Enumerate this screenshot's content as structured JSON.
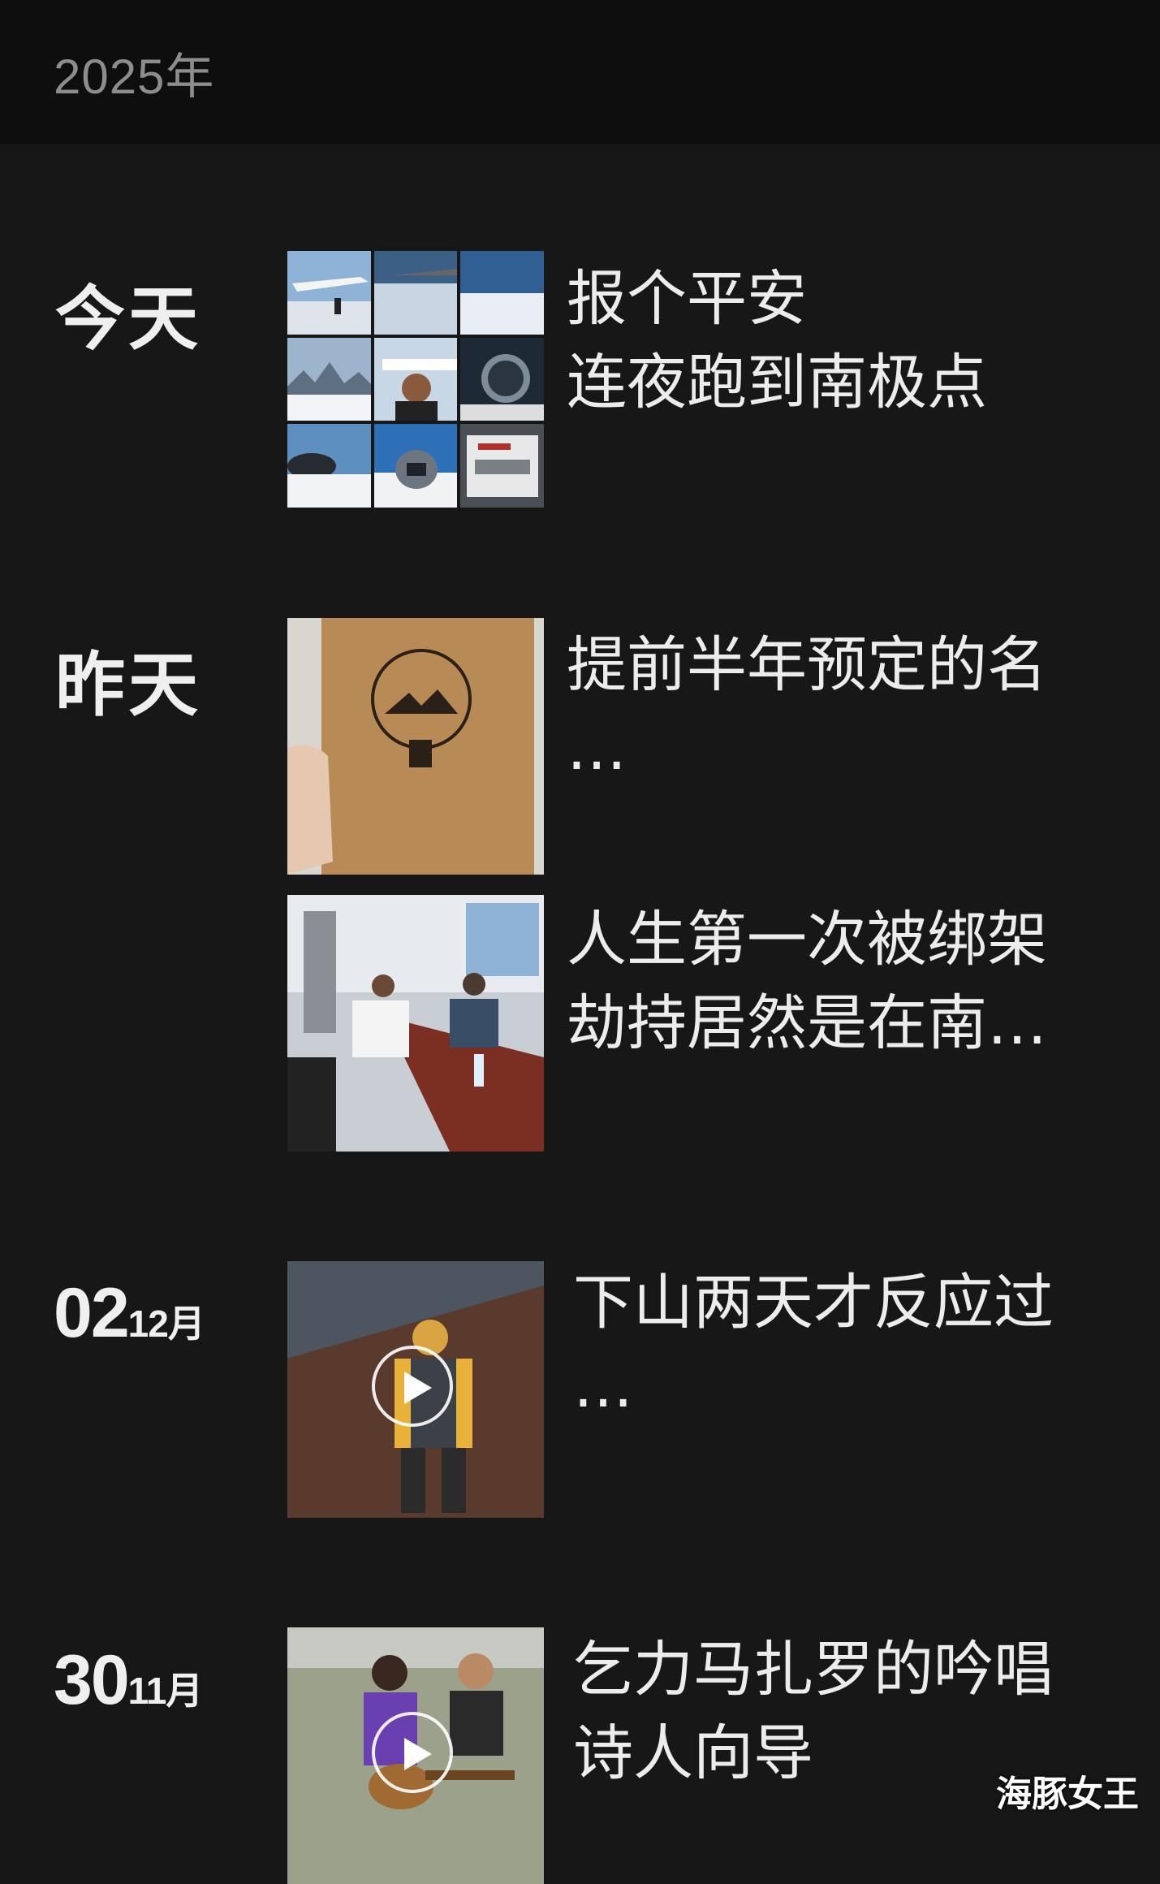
{
  "header": {
    "year": "2025年"
  },
  "entries": [
    {
      "date": "今天",
      "title_line1": "报个平安",
      "title_line2": "连夜跑到南极点"
    },
    {
      "date": "昨天",
      "title_line1": "提前半年预定的名",
      "title_line2": "…"
    },
    {
      "title_line1": "人生第一次被绑架",
      "title_line2": "劫持居然是在南…"
    },
    {
      "day": "02",
      "month": "12月",
      "title_line1": "下山两天才反应过",
      "title_line2": "…"
    },
    {
      "day": "30",
      "month": "11月",
      "title_line1": "乞力马扎罗的吟唱",
      "title_line2": "诗人向导"
    }
  ],
  "watermark": "海豚女王"
}
